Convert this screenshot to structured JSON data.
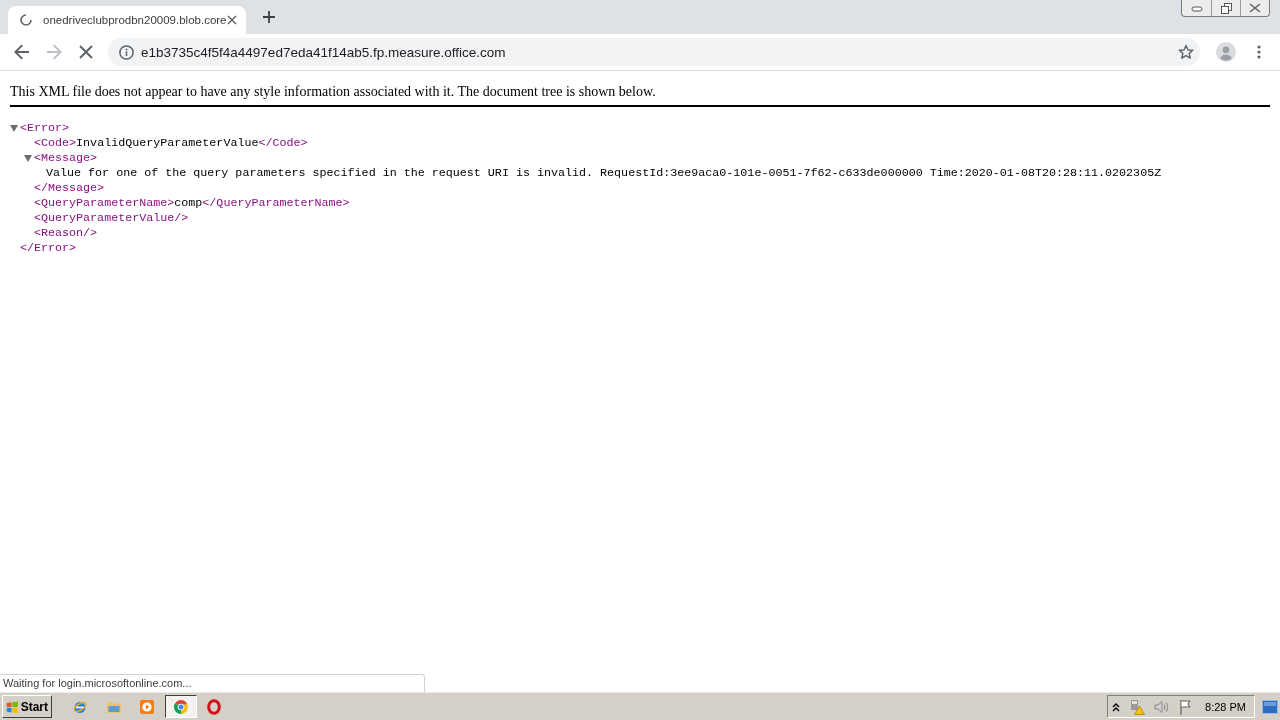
{
  "tabs": [
    {
      "title": "onedriveclubprodbn20009.blob.core",
      "loading": true,
      "selected": true
    }
  ],
  "toolbar": {
    "back": {
      "disabled": false
    },
    "forward": {
      "disabled": true
    },
    "loading": true,
    "url": "e1b3735c4f5f4a4497ed7eda41f14ab5.fp.measure.office.com"
  },
  "page": {
    "notice": "This XML file does not appear to have any style information associated with it. The document tree is shown below.",
    "tree": [
      {
        "kind": "element",
        "open_tag": "<Error>",
        "expanded": true,
        "children": [
          {
            "kind": "inline",
            "open_tag": "<Code>",
            "text": "InvalidQueryParameterValue",
            "close_tag": "</Code>"
          },
          {
            "kind": "element",
            "open_tag": "<Message>",
            "expanded": true,
            "children": [
              {
                "kind": "text",
                "text": "Value for one of the query parameters specified in the request URI is invalid. RequestId:3ee9aca0-101e-0051-7f62-c633de000000 Time:2020-01-08T20:28:11.0202305Z"
              }
            ],
            "close_tag": "</Message>"
          },
          {
            "kind": "inline",
            "open_tag": "<QueryParameterName>",
            "text": "comp",
            "close_tag": "</QueryParameterName>"
          },
          {
            "kind": "empty",
            "tag": "<QueryParameterValue/>"
          },
          {
            "kind": "empty",
            "tag": "<Reason/>"
          }
        ],
        "close_tag": "</Error>"
      }
    ]
  },
  "status_bubble": {
    "text": "Waiting for login.microsoftonline.com..."
  },
  "taskbar": {
    "start_label": "Start",
    "apps": [
      {
        "kind": "globe",
        "selected": false
      },
      {
        "kind": "folder",
        "selected": false
      },
      {
        "kind": "media",
        "selected": false
      },
      {
        "kind": "wheel",
        "selected": true
      },
      {
        "kind": "ring",
        "selected": false
      }
    ],
    "clock": "8:28 PM"
  }
}
